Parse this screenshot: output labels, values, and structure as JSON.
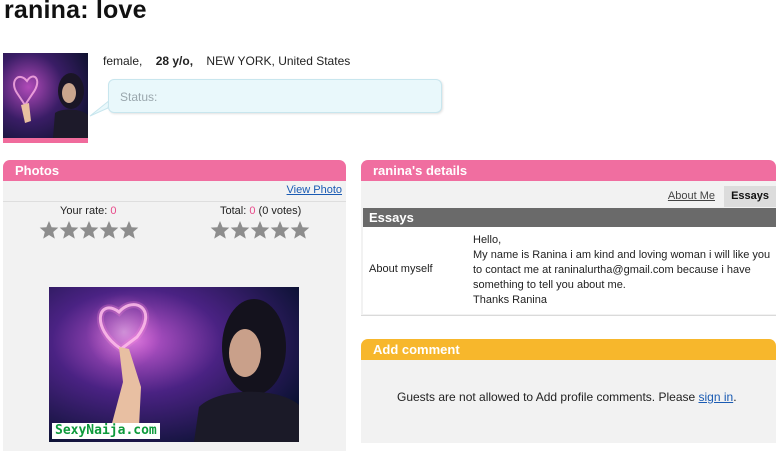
{
  "profile": {
    "title": "ranina: love",
    "gender": "female,",
    "age": "28 y/o,",
    "location": "NEW YORK, United States",
    "status_label": "Status:"
  },
  "photos": {
    "header": "Photos",
    "view_photo": "View Photo",
    "your_rate_label": "Your rate:",
    "your_rate_value": "0",
    "total_label": "Total:",
    "total_value": "0",
    "votes": "(0 votes)",
    "watermark": "SexyNaija.com"
  },
  "details": {
    "header": "ranina's details",
    "tabs": [
      {
        "label": "About Me"
      },
      {
        "label": "Essays"
      }
    ],
    "section_title": "Essays",
    "essay_label": "About myself",
    "essay_lines": [
      "Hello,",
      "My name is Ranina i am kind and loving woman i will like you",
      "to contact me at raninalurtha@gmail.com because i have",
      "something to tell you about me.",
      "Thanks Ranina"
    ]
  },
  "comments": {
    "header": "Add comment",
    "message": "Guests are not allowed to Add profile comments. Please",
    "sign_in": "sign in",
    "period": "."
  },
  "colors": {
    "pink": "#f06ea0",
    "orange": "#f7b72c",
    "link": "#1a5bb3"
  }
}
